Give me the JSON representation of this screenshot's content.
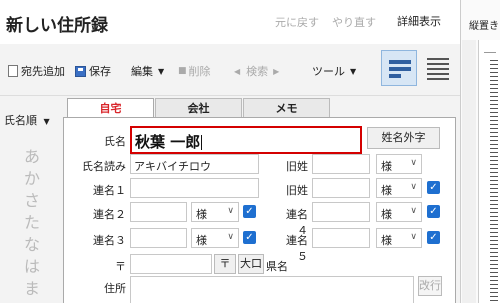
{
  "app": {
    "title": "新しい住所録",
    "undo_label": "元に戻す",
    "redo_label": "やり直す",
    "detail_label": "詳細表示"
  },
  "toolbar": {
    "add_label": "宛先追加",
    "save_label": "保存",
    "edit_label": "編集",
    "delete_label": "削除",
    "search_label": "検索",
    "tools_label": "ツール"
  },
  "index": {
    "sort_label": "氏名順",
    "kana": [
      "あ",
      "か",
      "さ",
      "た",
      "な",
      "は",
      "ま"
    ]
  },
  "tabs": [
    {
      "label": "自宅",
      "active": true
    },
    {
      "label": "会社",
      "active": false
    },
    {
      "label": "メモ",
      "active": false
    }
  ],
  "form": {
    "name_label": "氏名",
    "name_value": "秋葉 一郎",
    "name_ext_button": "姓名外字",
    "reading_label": "氏名読み",
    "reading_value": "アキバイチロウ",
    "old_surname_label": "旧姓",
    "renmei1_label": "連名１",
    "renmei2_label": "連名２",
    "renmei3_label": "連名３",
    "renmei4_label": "連名４",
    "renmei5_label": "連名５",
    "honorific": "様",
    "postal_mark": "〒",
    "postal_button": "〒",
    "oguchi_button": "大口",
    "prefecture_label": "県名",
    "address_label": "住所",
    "newline_button": "改行"
  },
  "side_panel": {
    "title": "縦置き"
  },
  "colors": {
    "accent": "#d9262b",
    "highlight_border": "#d40000",
    "checkbox": "#1e6fd0"
  }
}
